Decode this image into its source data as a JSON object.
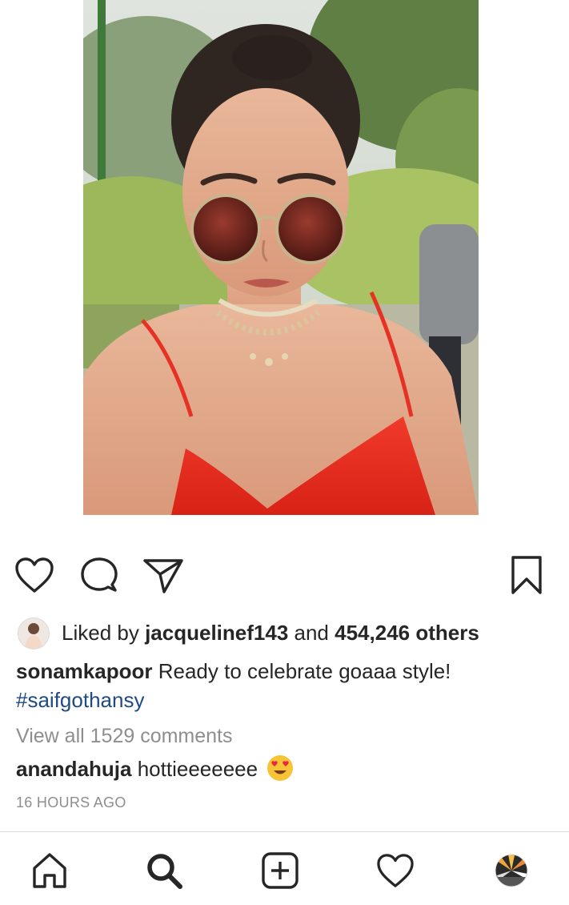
{
  "post": {
    "photo": {
      "icon": "post-photo-woman-red-dress-sunglasses"
    },
    "actions": {
      "like_icon": "heart-outline-icon",
      "comment_icon": "comment-bubble-icon",
      "share_icon": "paper-plane-icon",
      "save_icon": "bookmark-icon"
    },
    "likes": {
      "prefix": "Liked by",
      "liker_username": "jacquelinef143",
      "connector": "and",
      "others_count": "454,246 others"
    },
    "caption": {
      "username": "sonamkapoor",
      "text": "Ready to celebrate goaaa style!",
      "hashtag": "#saifgothansy"
    },
    "view_all_comments": "View all 1529 comments",
    "comment": {
      "username": "anandahuja",
      "text": "hottieeeeeee",
      "emoji": "heart-eyes-emoji"
    },
    "timestamp": "16 HOURS AGO"
  },
  "bottom_nav": {
    "items": [
      {
        "icon": "home-icon"
      },
      {
        "icon": "search-icon"
      },
      {
        "icon": "new-post-icon"
      },
      {
        "icon": "activity-heart-icon"
      },
      {
        "icon": "profile-avatar-icon"
      }
    ]
  }
}
